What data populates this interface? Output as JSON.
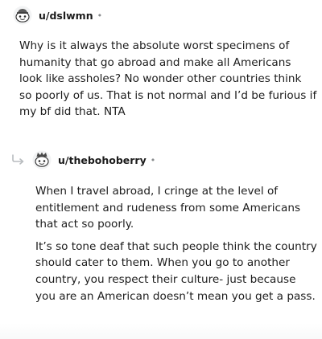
{
  "comments": [
    {
      "username": "u/dslwmn",
      "separator": "•",
      "avatar_icon": "snoo-avatar-icon",
      "paragraphs": [
        "Why is it always the absolute worst specimens of humanity that go abroad and make all Americans look like assholes? No wonder other countries think so poorly of us. That is not normal and I’d be furious if my bf did that. NTA"
      ]
    },
    {
      "username": "u/thebohoberry",
      "separator": "•",
      "avatar_icon": "snoo-avatar-icon",
      "reply_icon": "reply-arrow-icon",
      "paragraphs": [
        "When I travel abroad, I cringe at the level of entitlement and rudeness from some Americans that act so poorly.",
        "It’s so tone deaf that such people think the country should cater to them. When you go to another country, you respect their culture- just because you are an American doesn’t mean you get a pass."
      ]
    }
  ]
}
